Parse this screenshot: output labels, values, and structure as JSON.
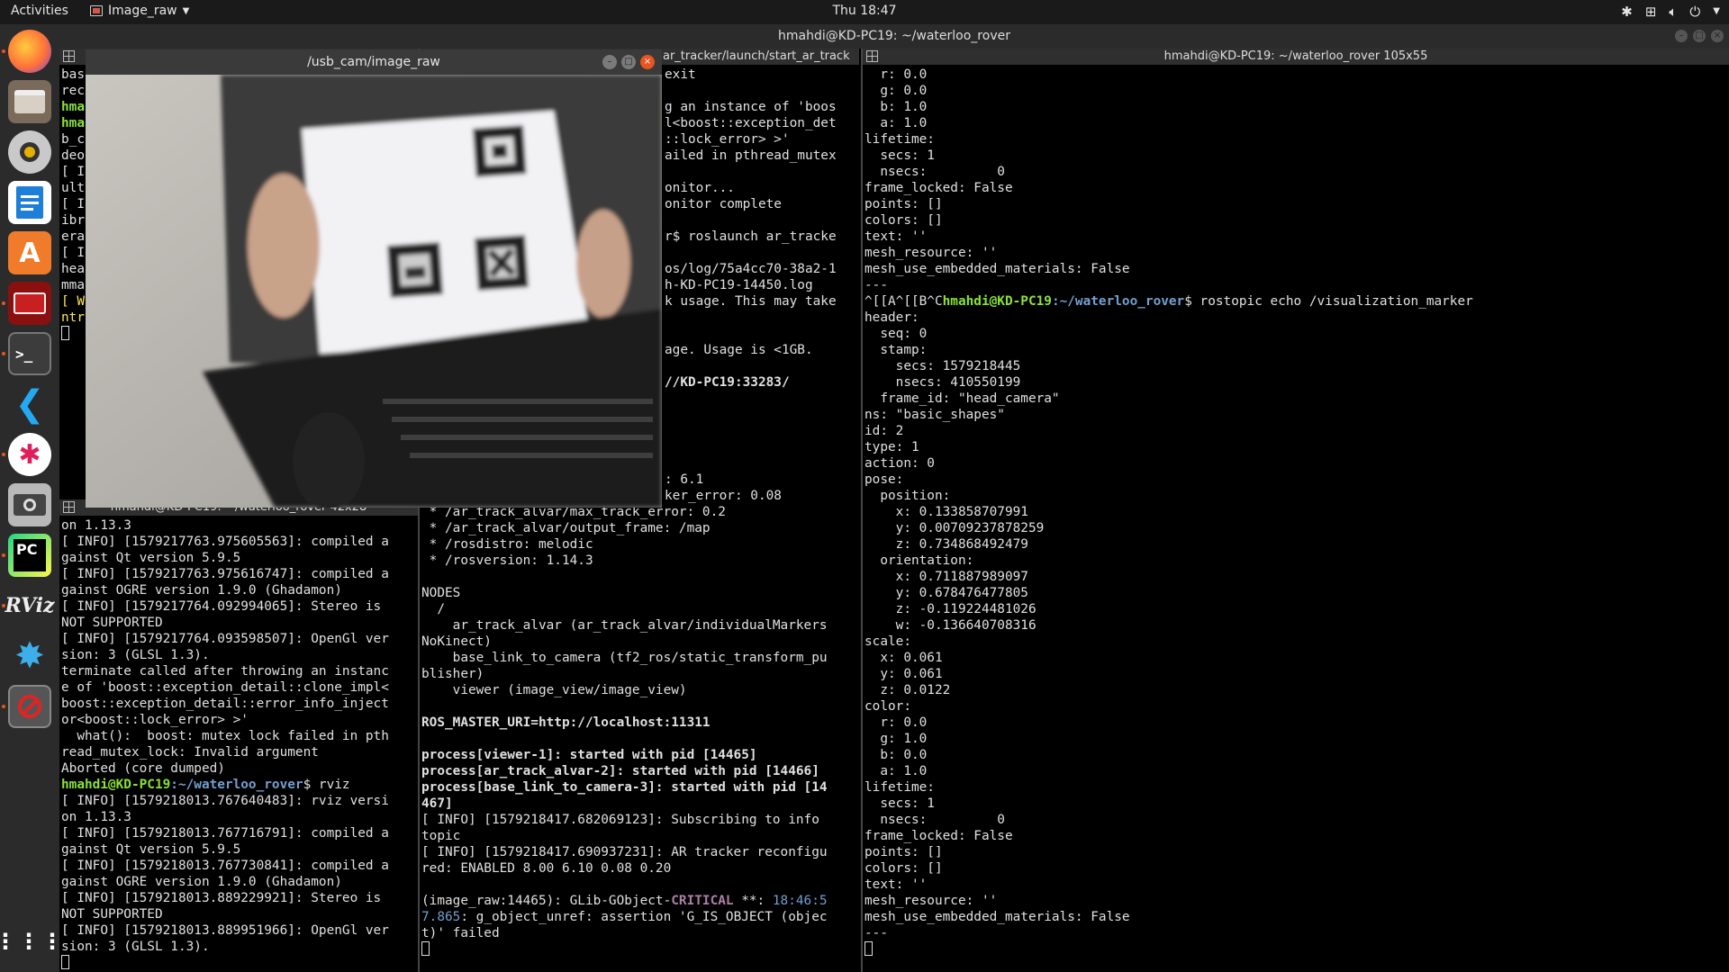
{
  "topbar": {
    "activities": "Activities",
    "app_name": "Image_raw",
    "clock": "Thu 18:47"
  },
  "main_window_title": "hmahdi@KD-PC19: ~/waterloo_rover",
  "image_window": {
    "title": "/usb_cam/image_raw"
  },
  "dock": {
    "items": [
      "firefox",
      "files",
      "rhythmbox",
      "libreoffice-writer",
      "ubuntu-software",
      "video-app",
      "terminal",
      "vscode",
      "slack",
      "screenshot",
      "pycharm",
      "rviz",
      "kde-app",
      "disabled-app"
    ],
    "labels": {
      "pycharm": "PC",
      "rviz": "RViz"
    }
  },
  "term_left_top": {
    "lines": [
      "bas",
      "rec",
      "hma",
      "hma",
      "b_c",
      "deo",
      "[ I",
      "ult",
      "[ I",
      "ibr",
      "era",
      "[ I",
      "hea",
      "mma",
      "[ W",
      "ntr"
    ]
  },
  "term_left_bottom": {
    "title": "hmahdi@KD-PC19: ~/waterloo_rover 42x28",
    "lines": [
      "on 1.13.3",
      "[ INFO] [1579217763.975605563]: compiled a",
      "gainst Qt version 5.9.5",
      "[ INFO] [1579217763.975616747]: compiled a",
      "gainst OGRE version 1.9.0 (Ghadamon)",
      "[ INFO] [1579217764.092994065]: Stereo is",
      "NOT SUPPORTED",
      "[ INFO] [1579217764.093598507]: OpenGl ver",
      "sion: 3 (GLSL 1.3).",
      "terminate called after throwing an instanc",
      "e of 'boost::exception_detail::clone_impl<",
      "boost::exception_detail::error_info_inject",
      "or<boost::lock_error> >'",
      "  what():  boost: mutex lock failed in pth",
      "read_mutex_lock: Invalid argument",
      "Aborted (core dumped)",
      "PROMPT|rviz",
      "[ INFO] [1579218013.767640483]: rviz versi",
      "on 1.13.3",
      "[ INFO] [1579218013.767716791]: compiled a",
      "gainst Qt version 5.9.5",
      "[ INFO] [1579218013.767730841]: compiled a",
      "gainst OGRE version 1.9.0 (Ghadamon)",
      "[ INFO] [1579218013.889229921]: Stereo is",
      "NOT SUPPORTED",
      "[ INFO] [1579218013.889951966]: OpenGl ver",
      "sion: 3 (GLSL 1.3)."
    ],
    "prompt_user": "hmahdi@KD-PC19",
    "prompt_path": ":~/waterloo_rover"
  },
  "term_middle": {
    "title": "ar_tracker/launch/start_ar_track",
    "lines_top": [
      "exit",
      "",
      "g an instance of 'boos",
      "l<boost::exception_det",
      "::lock_error> >'",
      "ailed in pthread_mutex",
      "",
      "onitor...",
      "onitor complete",
      "",
      "r$ roslaunch ar_tracke",
      "",
      "os/log/75a4cc70-38a2-1",
      "h-KD-PC19-14450.log",
      "k usage. This may take",
      "",
      "",
      "age. Usage is <1GB.",
      "",
      "//KD-PC19:33283/",
      "",
      "",
      "",
      "",
      "",
      ": 6.1",
      "ker_error: 0.08"
    ],
    "lines_bottom": [
      " * /ar_track_alvar/max_track_error: 0.2",
      " * /ar_track_alvar/output_frame: /map",
      " * /rosdistro: melodic",
      " * /rosversion: 1.14.3",
      "",
      "NODES",
      "  /",
      "    ar_track_alvar (ar_track_alvar/individualMarkers",
      "NoKinect)",
      "    base_link_to_camera (tf2_ros/static_transform_pu",
      "blisher)",
      "    viewer (image_view/image_view)",
      "",
      "ROS_MASTER_URI=http://localhost:11311",
      "",
      "process[viewer-1]: started with pid [14465]",
      "process[ar_track_alvar-2]: started with pid [14466]",
      "process[base_link_to_camera-3]: started with pid [14",
      "467]",
      "[ INFO] [1579218417.682069123]: Subscribing to info",
      "topic",
      "[ INFO] [1579218417.690937231]: AR tracker reconfigu",
      "red: ENABLED 8.00 6.10 0.08 0.20",
      "",
      "(image_raw:14465): GLib-GObject-CRITICAL **: 18:46:5",
      "7.865: g_object_unref: assertion 'G_IS_OBJECT (objec",
      "t)' failed"
    ]
  },
  "term_right": {
    "title": "hmahdi@KD-PC19: ~/waterloo_rover 105x55",
    "lines_before": [
      "  r: 0.0",
      "  g: 0.0",
      "  b: 1.0",
      "  a: 1.0",
      "lifetime:",
      "  secs: 1",
      "  nsecs:         0",
      "frame_locked: False",
      "points: []",
      "colors: []",
      "text: ''",
      "mesh_resource: ''",
      "mesh_use_embedded_materials: False",
      "---"
    ],
    "cmd_prefix": "^[[A^[[B^C",
    "prompt_user": "hmahdi@KD-PC19",
    "prompt_path": ":~/waterloo_rover",
    "command": "$ rostopic echo /visualization_marker",
    "lines_after": [
      "header:",
      "  seq: 0",
      "  stamp:",
      "    secs: 1579218445",
      "    nsecs: 410550199",
      "  frame_id: \"head_camera\"",
      "ns: \"basic_shapes\"",
      "id: 2",
      "type: 1",
      "action: 0",
      "pose:",
      "  position:",
      "    x: 0.133858707991",
      "    y: 0.00709237878259",
      "    z: 0.734868492479",
      "  orientation:",
      "    x: 0.711887989097",
      "    y: 0.678476477805",
      "    z: -0.119224481026",
      "    w: -0.136640708316",
      "scale:",
      "  x: 0.061",
      "  y: 0.061",
      "  z: 0.0122",
      "color:",
      "  r: 0.0",
      "  g: 1.0",
      "  b: 0.0",
      "  a: 1.0",
      "lifetime:",
      "  secs: 1",
      "  nsecs:         0",
      "frame_locked: False",
      "points: []",
      "colors: []",
      "text: ''",
      "mesh_resource: ''",
      "mesh_use_embedded_materials: False",
      "---"
    ]
  },
  "colors": {
    "prompt_green": "#8ae234",
    "path_blue": "#729fcf",
    "warning_yellow": "#fce94f",
    "critical_purple": "#ad7fa8",
    "ubuntu_orange": "#e95420"
  }
}
